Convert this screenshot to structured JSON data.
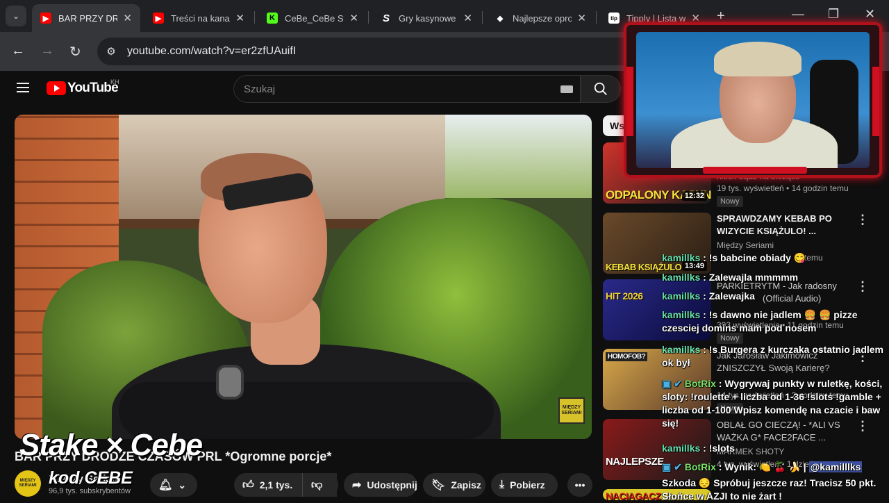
{
  "browser": {
    "tabs": [
      {
        "title": "BAR PRZY DROG",
        "icon": "youtube-icon",
        "active": true
      },
      {
        "title": "Treści na kanal",
        "icon": "youtube-icon"
      },
      {
        "title": "CeBe_CeBe Stre",
        "icon": "kick-icon"
      },
      {
        "title": "Gry kasynowe",
        "icon": "stake-icon"
      },
      {
        "title": "Najlepsze opro",
        "icon": "diamond-icon"
      },
      {
        "title": "Tipply | Lista w",
        "icon": "tipply-icon"
      }
    ],
    "url": "youtube.com/watch?v=er2zfUAuifI"
  },
  "youtube": {
    "logo_text": "YouTube",
    "country_code": "KH",
    "search_placeholder": "Szukaj",
    "video": {
      "title": "BAR PRZY DRODZE CZASÓW PRL *Ogromne porcje*",
      "channel": "Między Seriami",
      "subscribers": "96,9 tys. subskrybentów",
      "likes": "2,1 tys.",
      "share_label": "Udostępnij",
      "save_label": "Zapisz",
      "download_label": "Pobierz",
      "corner_badge": "MIĘDZY SERIAMI"
    },
    "chip_label": "Ws",
    "sidebar": [
      {
        "thumb_text": "ODPALONY KASYN",
        "duration": "12:32",
        "title": "niech bądź na bieżąco",
        "meta": "19 tys. wyświetleń • 14 godzin temu",
        "badge": "Nowy"
      },
      {
        "thumb_text": "KEBAB KSIĄŻULO",
        "duration": "13:49",
        "title": "SPRAWDZAMY KEBAB PO WIZYCIE KSIĄŻULO! ...",
        "channel": "Między Seriami",
        "meta": "temu"
      },
      {
        "thumb_text": "HIT 2026",
        "title": "PARKIETRYTM - Jak radosny",
        "meta": "(Official Audio)",
        "channel": "393 wyświetlenia • 11 godzin temu",
        "badge": "Nowy"
      },
      {
        "thumb_text": "HOMOFOB?",
        "title": "Jak Jarosław Jakimowicz ZNISZCZYŁ Swoją Karierę?",
        "meta": "14 tys. wyświetleń • 2 godziny temu",
        "badge": "Nowy"
      },
      {
        "thumb_text": "NAJLEPSZE",
        "title": "OBLAŁ GO CIECZĄ! - *ALI VS WAŻKA G* FACE2FACE ...",
        "channel": "MARMEK SHOTY",
        "meta": "4 tys. wyświetleń • 1 dzień temu"
      },
      {
        "thumb_text": "NACIĄGACZ"
      }
    ]
  },
  "stream_overlay": {
    "brand": "Stake × Cebe",
    "code": "kod CEBE",
    "chat": [
      {
        "user": "kamillks",
        "text": " : !s babcine obiady 😋"
      },
      {
        "user": "kamillks",
        "text": " : Zalewajla mmmmm"
      },
      {
        "user": "kamillks",
        "text": " : Zalewajka"
      },
      {
        "user": "kamillks",
        "text": " : !s dawno nie jadlem 🍔 🍔 pizze czesciej domins mam pod nosem"
      },
      {
        "user": "kamillks",
        "text": " : !s Burgera z kurczaka ostatnio jadlem ok był"
      },
      {
        "user": "BotRix",
        "text": " : Wygrywaj punkty w ruletkę, kości, sloty: !roulette + liczba od 1-36 !slots !gamble + liczba od 1-100 Wpisz komendę na czacie i baw się!"
      },
      {
        "user": "kamillks",
        "text": " : !slots"
      },
      {
        "user": "BotRix",
        "text": " : Wynik: 🍋 🍒 🍌 | ",
        "mention": "@kamilllks"
      },
      {
        "text": "Szkoda 😔 Spróbuj jeszcze raz! Tracisz 50 pkt. Słońce w AZJI to nie żart !"
      }
    ]
  },
  "colors": {
    "accent": "#ff0000",
    "chat_user": "#68e3b0",
    "cam_frame": "#b0111a"
  }
}
